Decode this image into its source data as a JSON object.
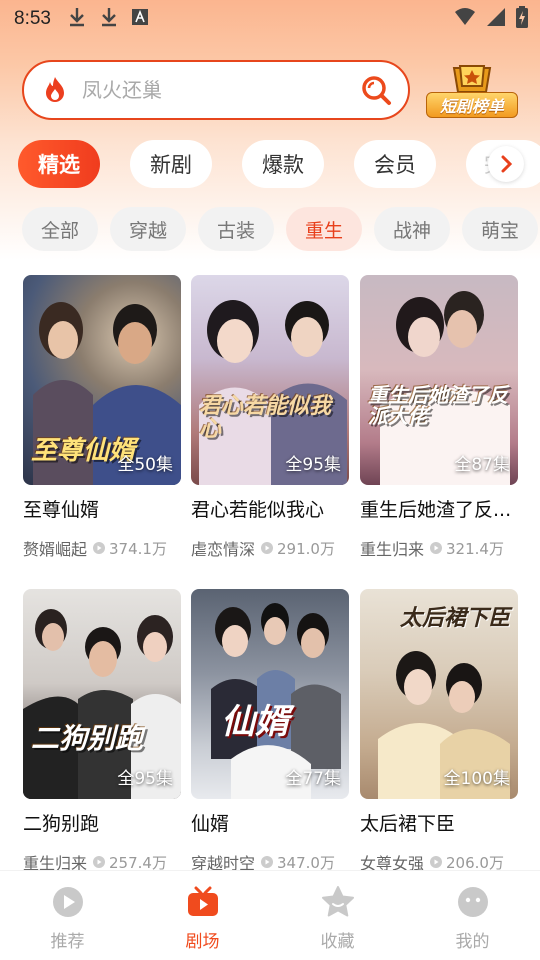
{
  "status_bar": {
    "time": "8:53"
  },
  "search": {
    "placeholder": "凤火还巢"
  },
  "rank_badge": {
    "label": "短剧榜单"
  },
  "main_tabs": [
    {
      "label": "精选",
      "active": true
    },
    {
      "label": "新剧",
      "active": false
    },
    {
      "label": "爆款",
      "active": false
    },
    {
      "label": "会员",
      "active": false
    },
    {
      "label": "完",
      "active": false
    }
  ],
  "sub_tabs": [
    {
      "label": "全部",
      "active": false
    },
    {
      "label": "穿越",
      "active": false
    },
    {
      "label": "古装",
      "active": false
    },
    {
      "label": "重生",
      "active": true
    },
    {
      "label": "战神",
      "active": false
    },
    {
      "label": "萌宝",
      "active": false
    }
  ],
  "dramas": [
    {
      "title": "至尊仙婿",
      "episodes": "全50集",
      "genre": "赘婿崛起",
      "views": "374.1万",
      "poster_text": "至尊仙婿"
    },
    {
      "title": "君心若能似我心",
      "episodes": "全95集",
      "genre": "虐恋情深",
      "views": "291.0万",
      "poster_text": "君心若能似我心"
    },
    {
      "title": "重生后她渣了反...",
      "episodes": "全87集",
      "genre": "重生归来",
      "views": "321.4万",
      "poster_text": "重生后她渣了反派大佬"
    },
    {
      "title": "二狗别跑",
      "episodes": "全95集",
      "genre": "重生归来",
      "views": "257.4万",
      "poster_text": "二狗别跑"
    },
    {
      "title": "仙婿",
      "episodes": "全77集",
      "genre": "穿越时空",
      "views": "347.0万",
      "poster_text": "仙婿"
    },
    {
      "title": "太后裙下臣",
      "episodes": "全100集",
      "genre": "女尊女强",
      "views": "206.0万",
      "poster_text": "太后裙下臣"
    }
  ],
  "bottom_nav": [
    {
      "label": "推荐",
      "icon": "play-circle-icon",
      "active": false
    },
    {
      "label": "剧场",
      "icon": "tv-icon",
      "active": true
    },
    {
      "label": "收藏",
      "icon": "star-icon",
      "active": false
    },
    {
      "label": "我的",
      "icon": "smile-face-icon",
      "active": false
    }
  ],
  "colors": {
    "accent": "#f04b1e",
    "accent_light": "#fde5de"
  }
}
